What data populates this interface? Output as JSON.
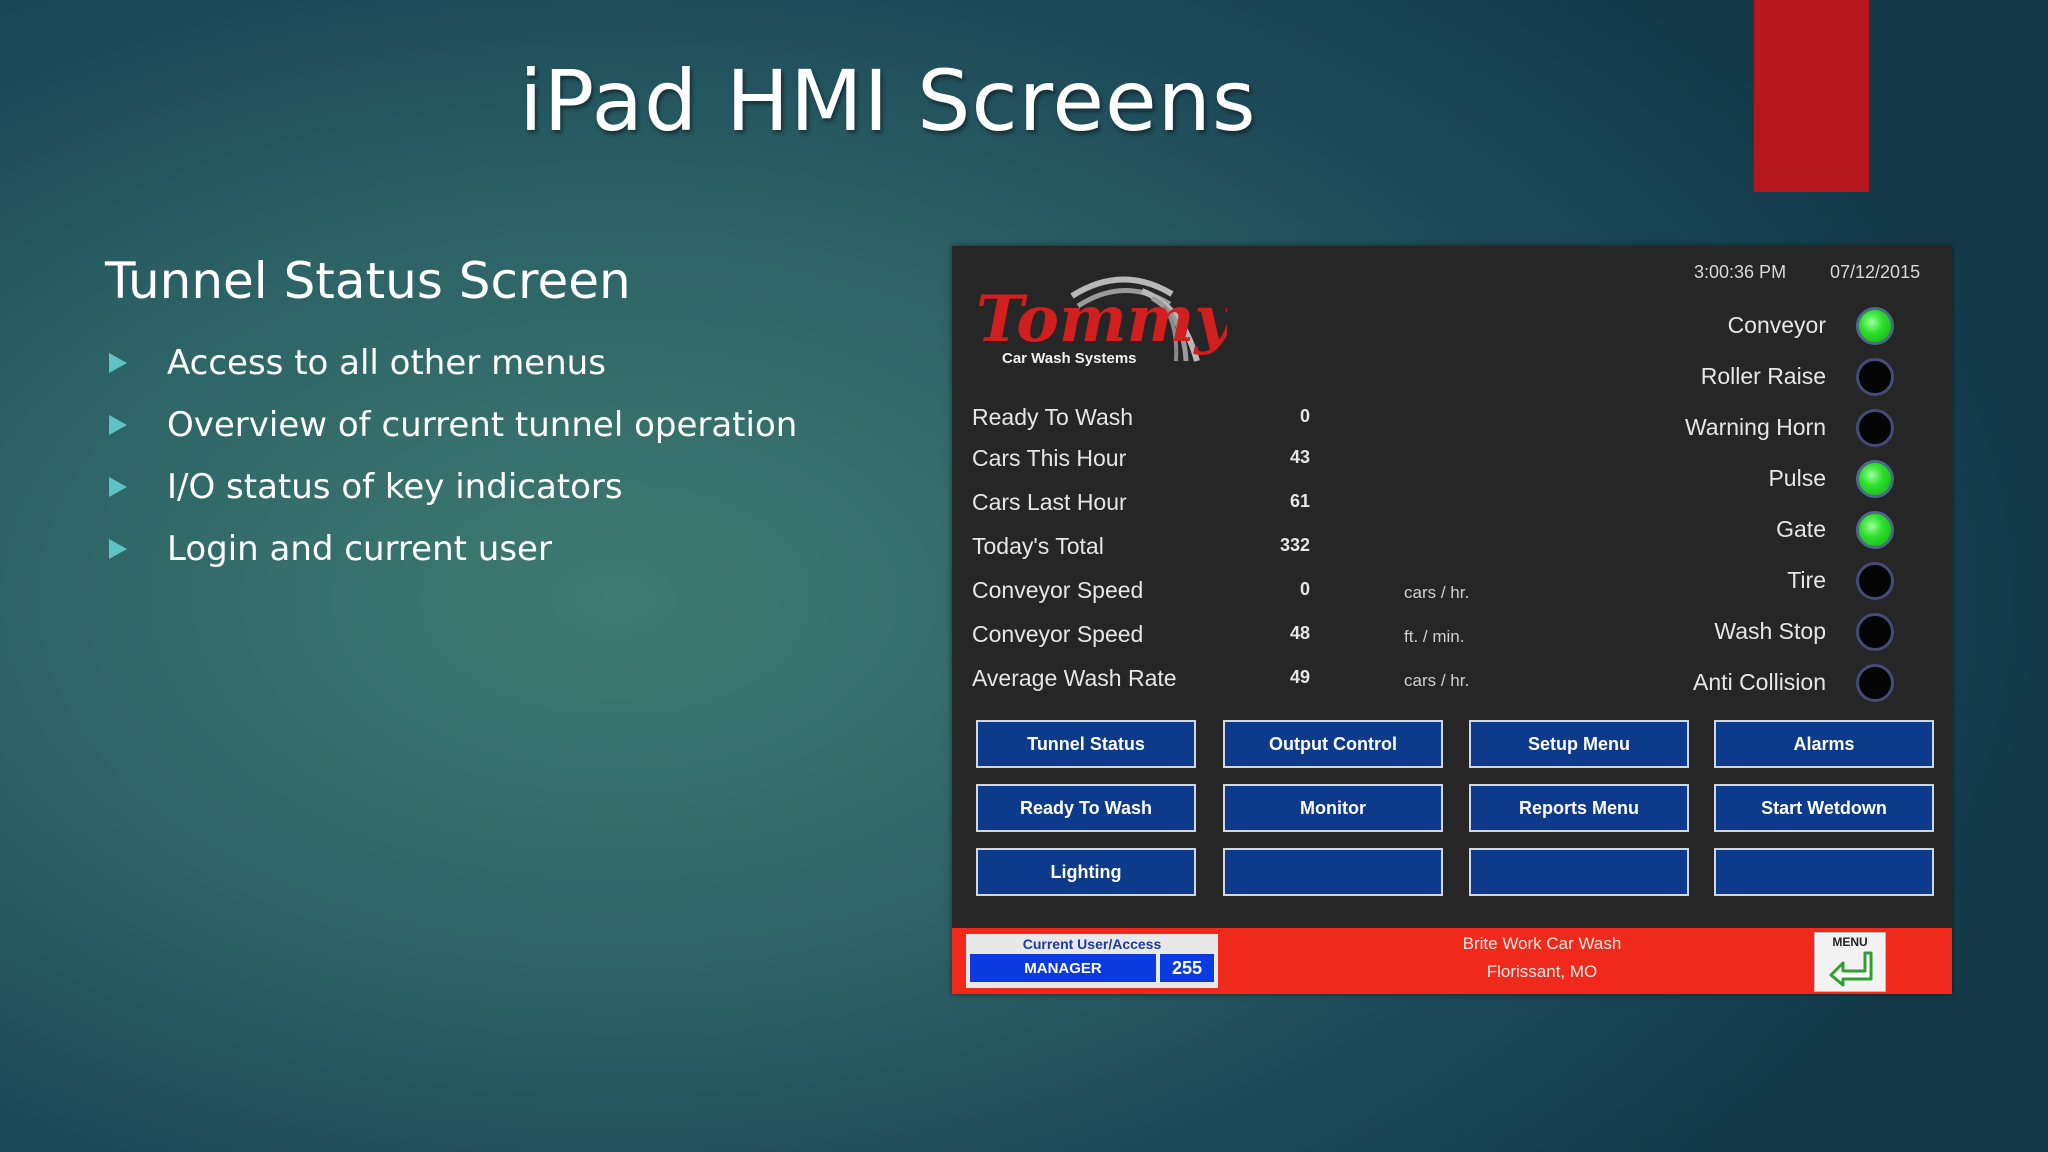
{
  "slide": {
    "title": "iPad HMI Screens",
    "subtitle": "Tunnel Status Screen",
    "bullets": [
      "Access to all other menus",
      "Overview of current tunnel operation",
      "I/O status of key indicators",
      "Login and current user"
    ],
    "accent_color": "#b5181c"
  },
  "hmi": {
    "logo": {
      "brand": "Tommy",
      "tagline": "Car Wash Systems"
    },
    "time": "3:00:36 PM",
    "date": "07/12/2015",
    "stats": [
      {
        "label": "Ready To Wash",
        "value": "0",
        "unit": ""
      },
      {
        "label": "Cars This Hour",
        "value": "43",
        "unit": ""
      },
      {
        "label": "Cars Last Hour",
        "value": "61",
        "unit": ""
      },
      {
        "label": "Today's Total",
        "value": "332",
        "unit": ""
      },
      {
        "label": "Conveyor Speed",
        "value": "0",
        "unit": "cars / hr."
      },
      {
        "label": "Conveyor Speed",
        "value": "48",
        "unit": "ft. / min."
      },
      {
        "label": "Average Wash Rate",
        "value": "49",
        "unit": "cars / hr."
      }
    ],
    "indicators": [
      {
        "label": "Conveyor",
        "on": true
      },
      {
        "label": "Roller Raise",
        "on": false
      },
      {
        "label": "Warning Horn",
        "on": false
      },
      {
        "label": "Pulse",
        "on": true
      },
      {
        "label": "Gate",
        "on": true
      },
      {
        "label": "Tire",
        "on": false
      },
      {
        "label": "Wash Stop",
        "on": false
      },
      {
        "label": "Anti Collision",
        "on": false
      }
    ],
    "buttons": [
      [
        "Tunnel Status",
        "Output Control",
        "Setup Menu",
        "Alarms"
      ],
      [
        "Ready To Wash",
        "Monitor",
        "Reports Menu",
        "Start Wetdown"
      ],
      [
        "Lighting",
        "",
        "",
        ""
      ]
    ],
    "footer": {
      "user_caption": "Current User/Access",
      "user_name": "MANAGER",
      "user_level": "255",
      "site_name": "Brite Work Car Wash",
      "site_location": "Florissant, MO",
      "menu_label": "MENU"
    },
    "colors": {
      "indicator_on": "#2de02d",
      "button_bg": "#0e3a8c",
      "footer_bg": "#f0291d"
    }
  }
}
